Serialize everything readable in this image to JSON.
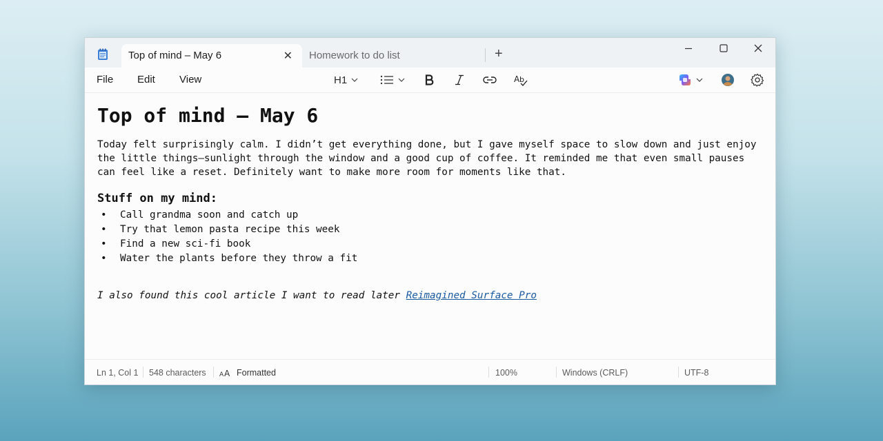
{
  "tabs": [
    {
      "label": "Top of mind – May 6",
      "active": true
    },
    {
      "label": "Homework to do list",
      "active": false
    }
  ],
  "menu": {
    "file": "File",
    "edit": "Edit",
    "view": "View"
  },
  "toolbar": {
    "heading_level": "H1"
  },
  "document": {
    "title": "Top of mind – May 6",
    "paragraph": "Today felt surprisingly calm. I didn’t get everything done, but I gave myself space to slow down and just enjoy the little things—sunlight through the window and a good cup of coffee. It reminded me that even small pauses can feel like a reset. Definitely want to make more room for moments like that.",
    "subheading": "Stuff on my mind:",
    "list": [
      "Call grandma soon and catch up",
      "Try that lemon pasta recipe this week",
      "Find a new sci-fi book",
      "Water the plants before they throw a fit"
    ],
    "closing_text": "I also found this cool article I want to read later ",
    "link_text": "Reimagined Surface Pro"
  },
  "status": {
    "position": "Ln 1, Col 1",
    "characters": "548 characters",
    "format": "Formatted",
    "zoom": "100%",
    "line_ending": "Windows (CRLF)",
    "encoding": "UTF-8"
  },
  "colors": {
    "link": "#1a5aa0",
    "copilot_accent": "#7a5cf5"
  }
}
